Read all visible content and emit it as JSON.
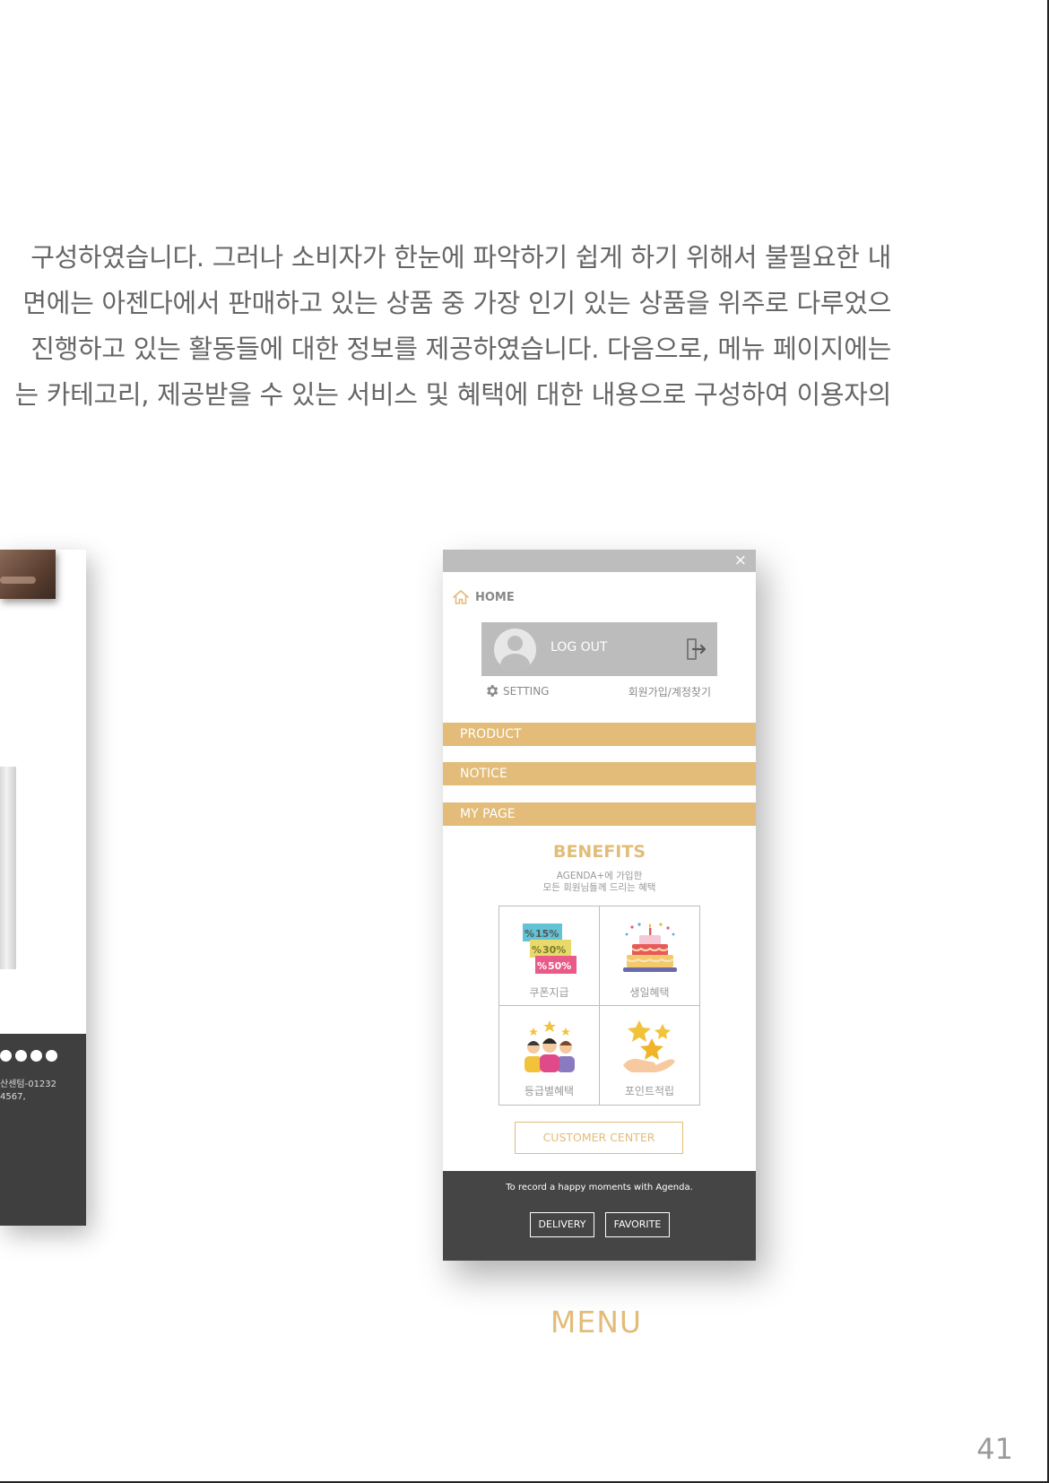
{
  "paragraph": {
    "lines": [
      "구성하였습니다. 그러나 소비자가 한눈에 파악하기 쉽게 하기 위해서 불필요한 내",
      "면에는 아젠다에서 판매하고 있는 상품 중 가장 인기 있는 상품을 위주로 다루었으",
      "진행하고 있는 활동들에 대한 정보를 제공하였습니다. 다음으로, 메뉴 페이지에는",
      "는 카테고리, 제공받을 수 있는 서비스 및 혜택에 대한 내용으로 구성하여 이용자의"
    ]
  },
  "left_mockup": {
    "footer_text_lines": [
      "산센텀-01232",
      "4567,"
    ]
  },
  "menu_screen": {
    "close_icon": "×",
    "home_label": "HOME",
    "logout_label": "LOG OUT",
    "setting_label": "SETTING",
    "join_label": "회원가입/계정찾기",
    "menu_items": [
      "PRODUCT",
      "NOTICE",
      "MY PAGE"
    ],
    "benefits": {
      "title": "BENEFITS",
      "subtitle_line1": "AGENDA+에 가입한",
      "subtitle_line2": "모든 회원님들께 드리는 혜택",
      "items": [
        {
          "label": "쿠폰지급",
          "icon": "coupon-icon",
          "coupons": [
            "15%",
            "30%",
            "50%"
          ],
          "percent_sign": "%"
        },
        {
          "label": "생일혜택",
          "icon": "birthday-cake-icon"
        },
        {
          "label": "등급별혜택",
          "icon": "member-grade-icon"
        },
        {
          "label": "포인트적립",
          "icon": "point-stars-icon"
        }
      ]
    },
    "customer_center_label": "CUSTOMER CENTER",
    "footer": {
      "tagline": "To record a happy moments with Agenda.",
      "buttons": [
        "DELIVERY",
        "FAVORITE"
      ]
    }
  },
  "caption": "MENU",
  "page_number": "41",
  "colors": {
    "accent": "#e2bc78",
    "gray_bar": "#bdbdbd",
    "footer_dark": "#454545",
    "body_text": "#666666"
  }
}
